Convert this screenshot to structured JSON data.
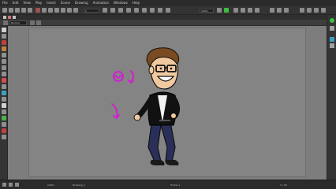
{
  "menu": {
    "items": [
      "File",
      "Edit",
      "View",
      "Play",
      "Insert",
      "Scene",
      "Drawing",
      "Animation",
      "Windows",
      "Help"
    ]
  },
  "toolbar": {
    "frame_field": "1",
    "zoom_field": "100%"
  },
  "tool_options": {
    "mode_select": "Normal"
  },
  "status": {
    "zoom": "100%",
    "frame_info": "Drawing_1",
    "center_label": "Frame 1",
    "right_info": "1 / 30"
  },
  "colors": {
    "menubar": "#2b2b2b",
    "panel": "#343434",
    "canvas": "#7d7d7d",
    "stage": "#848484",
    "magenta_strokes": "#d020d0",
    "accent_green": "#3fbf3f"
  },
  "icons": {
    "file_new": "file-icon",
    "select": "select-arrow-icon",
    "brush": "brush-icon",
    "pencil": "pencil-icon",
    "eraser": "eraser-icon",
    "fill": "paint-bucket-icon",
    "transform": "transform-icon",
    "camera": "camera-icon"
  }
}
